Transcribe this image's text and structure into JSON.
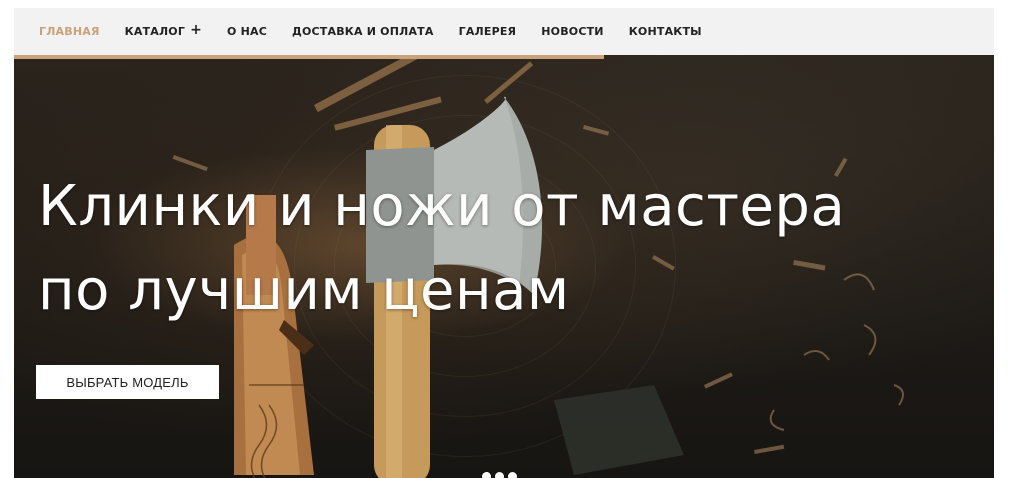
{
  "nav": {
    "items": [
      {
        "label": "ГЛАВНАЯ",
        "active": true
      },
      {
        "label": "КАТАЛОГ",
        "has_submenu": true
      },
      {
        "label": "О НАС"
      },
      {
        "label": "ДОСТАВКА И ОПЛАТА"
      },
      {
        "label": "ГАЛЕРЕЯ"
      },
      {
        "label": "НОВОСТИ"
      },
      {
        "label": "КОНТАКТЫ"
      }
    ],
    "submenu_icon": "plus-icon",
    "accent_color": "#c9a27a"
  },
  "hero": {
    "title_line1": "Клинки и ножи от мастера",
    "title_line2": "по лучшим ценам",
    "cta_label": "ВЫБРАТЬ МОДЕЛЬ",
    "slider_dot_count": 3
  }
}
